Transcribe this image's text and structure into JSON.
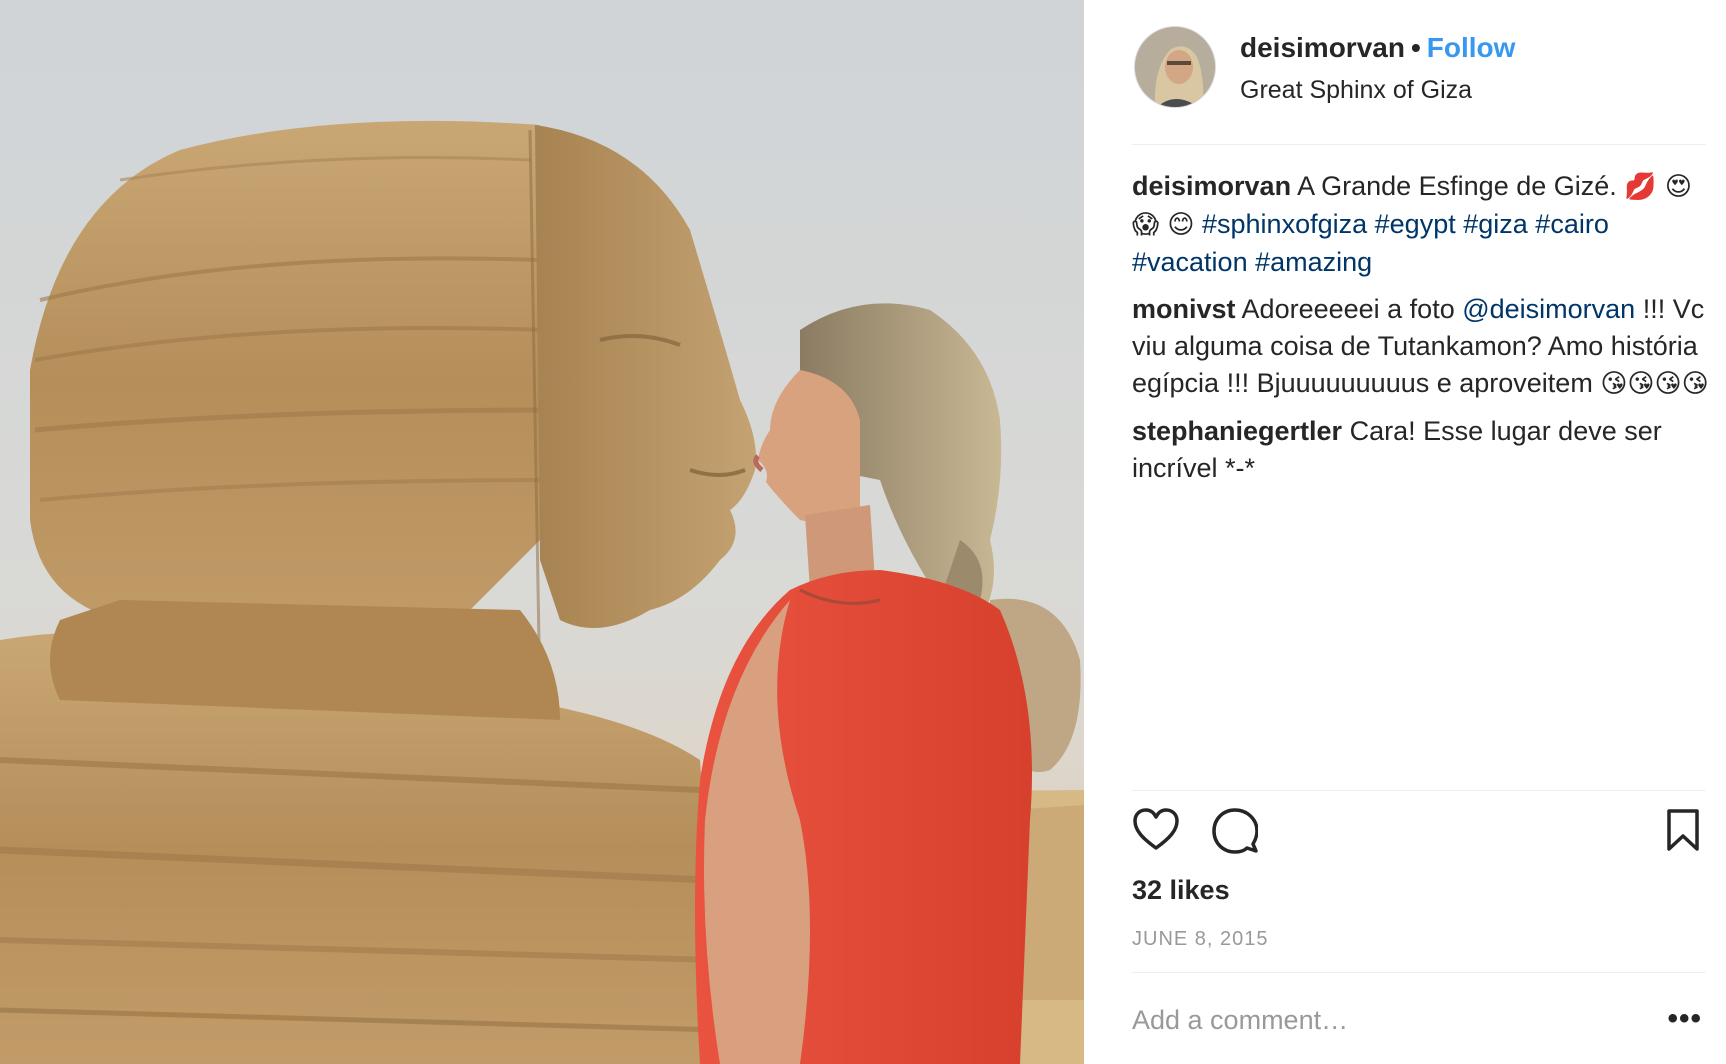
{
  "post": {
    "image_alt": "Woman kissing the Great Sphinx of Giza",
    "username": "deisimorvan",
    "separator": "•",
    "follow_label": "Follow",
    "location": "Great Sphinx of Giza",
    "caption": {
      "user": "deisimorvan",
      "text": "A Grande Esfinge de Gizé.",
      "emojis": "💋 😍 😱 😊",
      "hashtags": [
        "#sphinxofgiza",
        "#egypt",
        "#giza",
        "#cairo",
        "#vacation",
        "#amazing"
      ]
    },
    "comments": [
      {
        "user": "monivst",
        "text_before": "Adoreeeeei a foto",
        "mention": "@deisimorvan",
        "text_after": "!!! Vc viu alguma coisa de Tutankamon? Amo história egípcia !!! Bjuuuuuuuuus e aproveitem",
        "emojis": "😘😘😘😘"
      },
      {
        "user": "stephaniegertler",
        "text": "Cara! Esse lugar deve ser incrível *-*"
      }
    ],
    "actions": {
      "like_icon": "heart-icon",
      "comment_icon": "comment-bubble-icon",
      "save_icon": "bookmark-icon"
    },
    "likes": "32 likes",
    "date": "JUNE 8, 2015",
    "comment_placeholder": "Add a comment…",
    "more_label": "•••"
  },
  "colors": {
    "link_blue": "#3897f0",
    "hashtag": "#003569",
    "text": "#262626",
    "muted": "#999999",
    "divider": "#efefef"
  }
}
